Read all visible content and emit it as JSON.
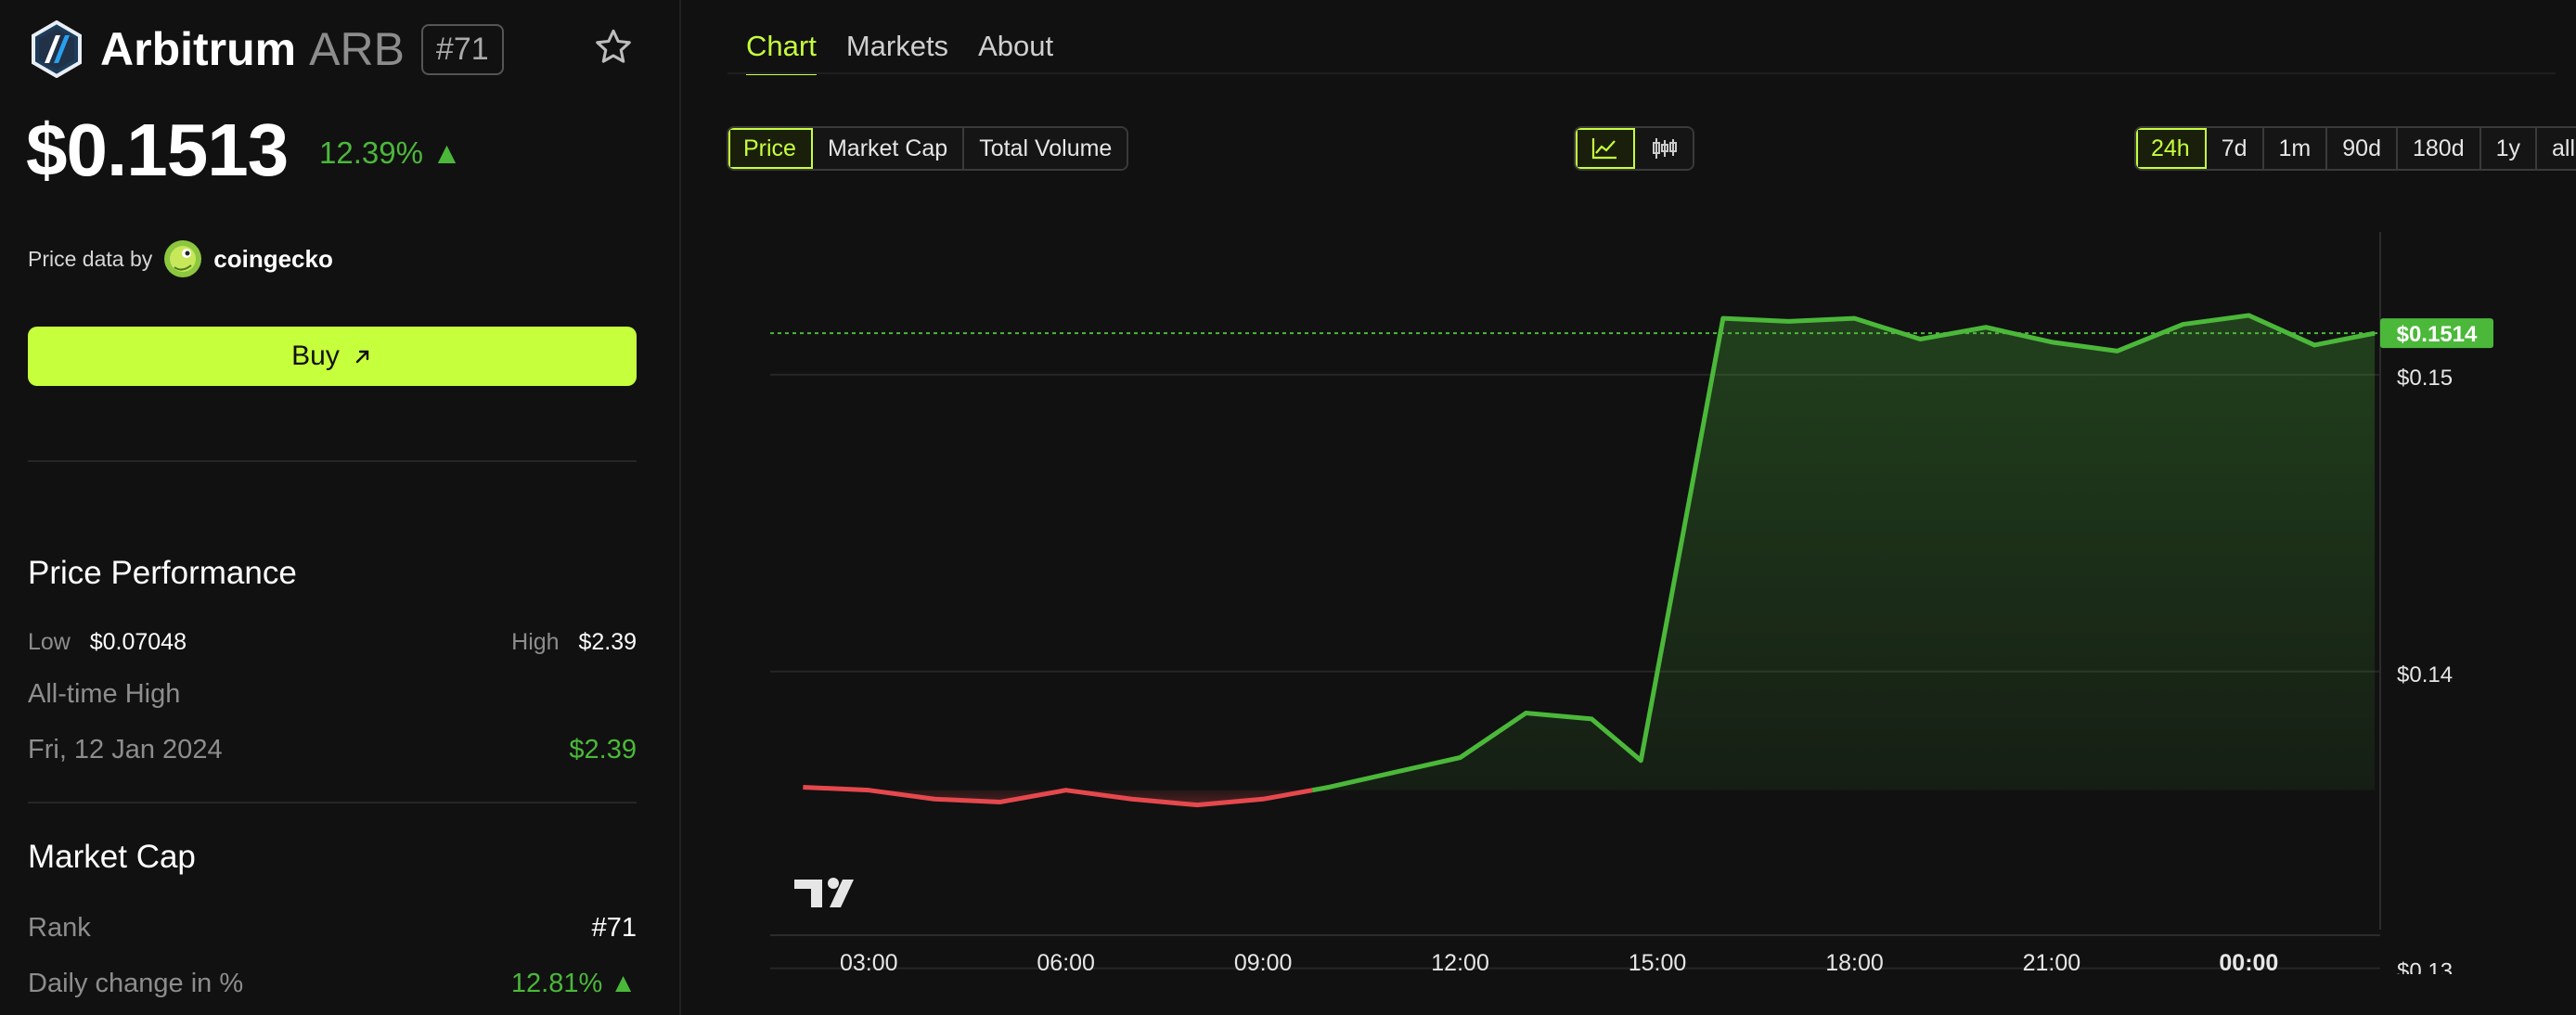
{
  "coin": {
    "name": "Arbitrum",
    "symbol": "ARB",
    "rank": "#71",
    "price": "$0.1513",
    "change": "12.39% ▲"
  },
  "price_data": {
    "label": "Price data by",
    "provider": "coingecko"
  },
  "buy": {
    "label": "Buy"
  },
  "performance": {
    "title": "Price Performance",
    "low_label": "Low",
    "low_value": "$0.07048",
    "high_label": "High",
    "high_value": "$2.39",
    "ath_label": "All-time High",
    "ath_date": "Fri, 12 Jan 2024",
    "ath_value": "$2.39"
  },
  "market_cap": {
    "title": "Market Cap",
    "rank_label": "Rank",
    "rank_value": "#71",
    "daily_label": "Daily change in %",
    "daily_value": "12.81% ▲"
  },
  "tabs": [
    "Chart",
    "Markets",
    "About"
  ],
  "metric_buttons": [
    "Price",
    "Market Cap",
    "Total Volume"
  ],
  "range_buttons": [
    "24h",
    "7d",
    "1m",
    "90d",
    "180d",
    "1y",
    "all"
  ],
  "colors": {
    "accent": "#c6ff3c",
    "up": "#4bb83a",
    "down": "#e5484d",
    "background": "#111111"
  },
  "icons": {
    "line_chart": "line-chart-icon",
    "candles": "candlestick-icon",
    "star": "star-icon",
    "arrow": "arrow-up-right-icon",
    "tradingview": "tradingview-logo"
  },
  "chart_data": {
    "type": "line",
    "x": [
      "02:00",
      "03:00",
      "04:00",
      "05:00",
      "06:00",
      "07:00",
      "08:00",
      "09:00",
      "10:00",
      "11:00",
      "12:00",
      "13:00",
      "14:00",
      "14:45",
      "16:00",
      "17:00",
      "18:00",
      "19:00",
      "20:00",
      "21:00",
      "22:00",
      "23:00",
      "00:00",
      "01:00",
      "01:55"
    ],
    "values": [
      0.1361,
      0.136,
      0.1357,
      0.1356,
      0.136,
      0.1357,
      0.1355,
      0.1357,
      0.1361,
      0.1366,
      0.1371,
      0.1386,
      0.1384,
      0.137,
      0.1519,
      0.1518,
      0.1519,
      0.1512,
      0.1516,
      0.1511,
      0.1508,
      0.1517,
      0.152,
      0.151,
      0.1514
    ],
    "baseline": 0.136,
    "current_label": "$0.1514",
    "current_value": 0.1514,
    "xticks": [
      "03:00",
      "06:00",
      "09:00",
      "12:00",
      "15:00",
      "18:00",
      "21:00",
      "00:00"
    ],
    "yticks": [
      "$0.13",
      "$0.14",
      "$0.15"
    ],
    "ylim": [
      0.1313,
      0.1545
    ],
    "grid": true
  }
}
